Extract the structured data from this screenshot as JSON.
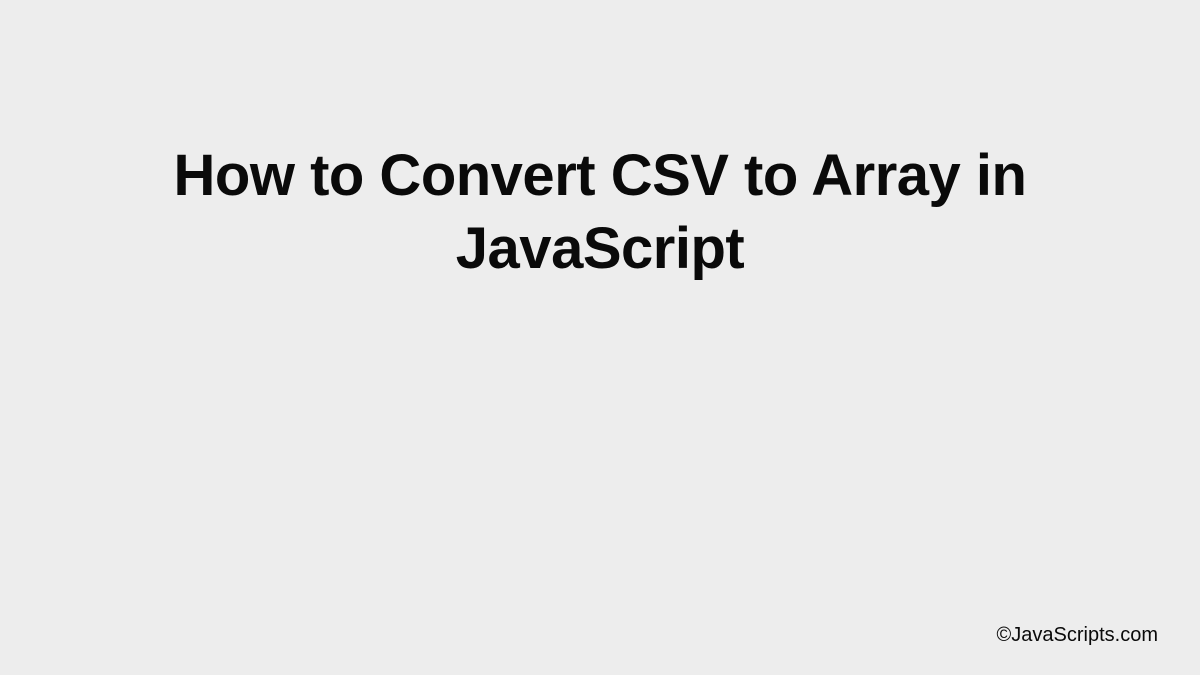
{
  "title": "How to Convert CSV to Array in JavaScript",
  "footer": "©JavaScripts.com"
}
